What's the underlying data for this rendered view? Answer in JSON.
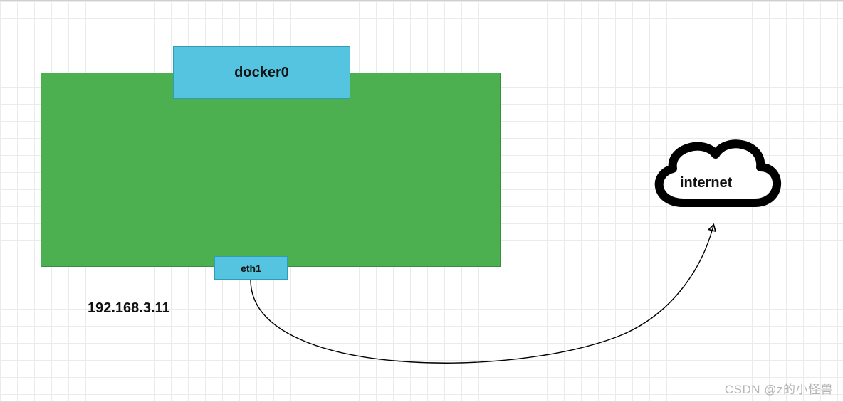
{
  "boxes": {
    "docker0_label": "docker0",
    "eth1_label": "eth1"
  },
  "ip_address": "192.168.3.11",
  "cloud_label": "internet",
  "watermark": "CSDN @z的小怪兽",
  "colors": {
    "host_fill": "#4caf50",
    "interface_fill": "#55c4e0",
    "cloud_stroke": "#000000"
  }
}
